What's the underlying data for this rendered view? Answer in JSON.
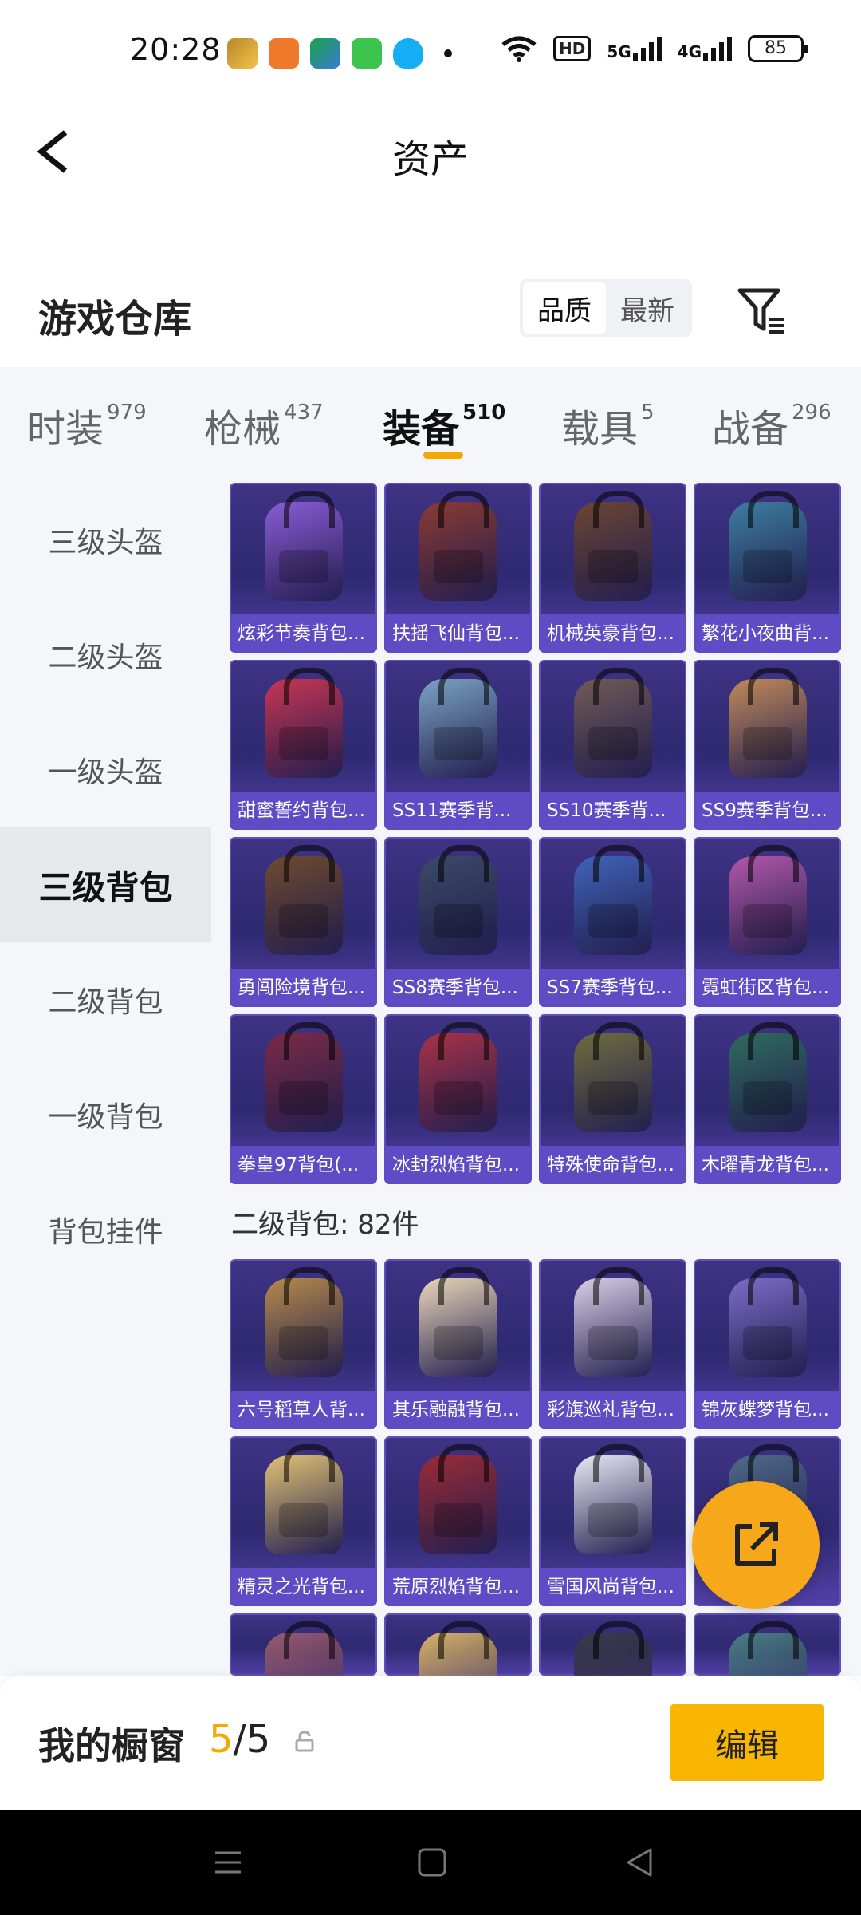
{
  "status_bar": {
    "time": "20:28",
    "app_icons": [
      "game-app-icon",
      "cf-app-icon",
      "kuaishou-icon",
      "messages-icon",
      "qq-icon"
    ],
    "wifi": "wifi-icon",
    "hd_label": "HD",
    "network_1": "5G",
    "network_2": "4G",
    "battery": "85"
  },
  "header": {
    "title": "资产",
    "back_icon": "back-chevron-icon"
  },
  "warehouse": {
    "title": "游戏仓库",
    "sort_options": [
      "品质",
      "最新"
    ],
    "sort_selected": "品质",
    "filter_icon": "filter-icon"
  },
  "tabs": [
    {
      "label": "时装",
      "count": "979"
    },
    {
      "label": "枪械",
      "count": "437"
    },
    {
      "label": "装备",
      "count": "510"
    },
    {
      "label": "载具",
      "count": "5"
    },
    {
      "label": "战备",
      "count": "296"
    }
  ],
  "active_tab": "装备",
  "sidebar": [
    {
      "label": "三级头盔"
    },
    {
      "label": "二级头盔"
    },
    {
      "label": "一级头盔"
    },
    {
      "label": "三级背包"
    },
    {
      "label": "二级背包"
    },
    {
      "label": "一级背包"
    },
    {
      "label": "背包挂件"
    }
  ],
  "sidebar_active": "三级背包",
  "level3_items": [
    {
      "name": "炫彩节奏背包...",
      "color": "#8b5cd6"
    },
    {
      "name": "扶摇飞仙背包...",
      "color": "#8a3a33"
    },
    {
      "name": "机械英豪背包...",
      "color": "#6b4532"
    },
    {
      "name": "繁花小夜曲背...",
      "color": "#3d7ea0"
    },
    {
      "name": "甜蜜誓约背包...",
      "color": "#c83552"
    },
    {
      "name": "SS11赛季背...",
      "color": "#7aa3c2"
    },
    {
      "name": "SS10赛季背...",
      "color": "#6f5a55"
    },
    {
      "name": "SS9赛季背包...",
      "color": "#c08a5a"
    },
    {
      "name": "勇闯险境背包...",
      "color": "#6e4a2d"
    },
    {
      "name": "SS8赛季背包...",
      "color": "#3a4a66"
    },
    {
      "name": "SS7赛季背包...",
      "color": "#3f63b8"
    },
    {
      "name": "霓虹街区背包...",
      "color": "#b257a9"
    },
    {
      "name": "拳皇97背包(...",
      "color": "#7b2a45"
    },
    {
      "name": "冰封烈焰背包...",
      "color": "#a73246"
    },
    {
      "name": "特殊使命背包...",
      "color": "#6d6c3e"
    },
    {
      "name": "木曜青龙背包...",
      "color": "#2f6a5e"
    }
  ],
  "level2_header": "二级背包: 82件",
  "level2_items": [
    {
      "name": "六号稻草人背...",
      "color": "#b58a4a"
    },
    {
      "name": "其乐融融背包...",
      "color": "#e8d7b8"
    },
    {
      "name": "彩旗巡礼背包...",
      "color": "#d9cfe6"
    },
    {
      "name": "锦灰蝶梦背包...",
      "color": "#7b6cc7"
    },
    {
      "name": "精灵之光背包...",
      "color": "#e0c274"
    },
    {
      "name": "荒原烈焰背包...",
      "color": "#9a2b35"
    },
    {
      "name": "雪国风尚背包...",
      "color": "#e8e8f4"
    },
    {
      "name": "",
      "color": "#4e6a88"
    }
  ],
  "level2_partial_colors": [
    "#9a5b73",
    "#d9b36b",
    "#3b3b4c",
    "#4b7d87"
  ],
  "fab_icon": "share-external-icon",
  "showcase": {
    "label": "我的橱窗",
    "current": "5",
    "separator": "/",
    "total": "5",
    "lock_icon": "lock-icon",
    "edit_label": "编辑"
  },
  "nav": [
    "menu-icon",
    "home-icon",
    "back-icon"
  ]
}
